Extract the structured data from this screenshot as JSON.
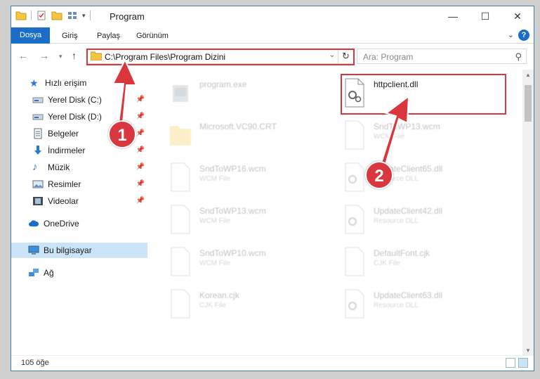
{
  "window": {
    "title": "Program",
    "controls": [
      "minimize",
      "maximize",
      "close"
    ]
  },
  "ribbon": {
    "tabs": [
      {
        "label": "Dosya",
        "active": true
      },
      {
        "label": "Giriş",
        "active": false
      },
      {
        "label": "Paylaş",
        "active": false
      },
      {
        "label": "Görünüm",
        "active": false
      }
    ],
    "help": "?"
  },
  "address": {
    "path": "C:\\Program Files\\Program Dizini",
    "search_placeholder": "Ara: Program"
  },
  "sidebar": {
    "items": [
      {
        "label": "Hızlı erişim",
        "icon": "star-icon",
        "pinned": false
      },
      {
        "label": "Yerel Disk (C:)",
        "icon": "drive-icon",
        "pinned": true
      },
      {
        "label": "Yerel Disk (D:)",
        "icon": "drive-icon",
        "pinned": true
      },
      {
        "label": "Belgeler",
        "icon": "documents-icon",
        "pinned": true
      },
      {
        "label": "İndirmeler",
        "icon": "download-icon",
        "pinned": true
      },
      {
        "label": "Müzik",
        "icon": "music-icon",
        "pinned": true
      },
      {
        "label": "Resimler",
        "icon": "pictures-icon",
        "pinned": true
      },
      {
        "label": "Videolar",
        "icon": "video-icon",
        "pinned": true
      },
      {
        "label": "OneDrive",
        "icon": "cloud-icon",
        "pinned": false
      },
      {
        "label": "Bu bilgisayar",
        "icon": "computer-icon",
        "pinned": false,
        "selected": true
      },
      {
        "label": "Ağ",
        "icon": "network-icon",
        "pinned": false
      }
    ]
  },
  "files": [
    {
      "name": "program.exe",
      "type": "",
      "faded": true,
      "kind": "exe"
    },
    {
      "name": "httpclient.dll",
      "type": "",
      "faded": false,
      "kind": "dll"
    },
    {
      "name": "Microsoft.VC90.CRT",
      "type": "",
      "faded": true,
      "kind": "folder"
    },
    {
      "name": "SndToWP13.wcm",
      "type": "WCM File",
      "faded": true,
      "kind": "doc"
    },
    {
      "name": "SndToWP16.wcm",
      "type": "WCM File",
      "faded": true,
      "kind": "doc"
    },
    {
      "name": "UpdateClient65.dll",
      "type": "Resource DLL",
      "faded": true,
      "kind": "dll"
    },
    {
      "name": "SndToWP13.wcm",
      "type": "WCM File",
      "faded": true,
      "kind": "doc"
    },
    {
      "name": "UpdateClient42.dll",
      "type": "Resource DLL",
      "faded": true,
      "kind": "dll"
    },
    {
      "name": "SndToWP10.wcm",
      "type": "WCM File",
      "faded": true,
      "kind": "doc"
    },
    {
      "name": "DefaultFont.cjk",
      "type": "CJK File",
      "faded": true,
      "kind": "doc"
    },
    {
      "name": "Korean.cjk",
      "type": "CJK File",
      "faded": true,
      "kind": "doc"
    },
    {
      "name": "UpdateClient63.dll",
      "type": "Resource DLL",
      "faded": true,
      "kind": "dll"
    }
  ],
  "status": {
    "count": "105 öğe"
  },
  "annotations": [
    {
      "label": "1"
    },
    {
      "label": "2"
    }
  ],
  "colors": {
    "accent": "#1a6ec7",
    "highlight": "#d9363e",
    "selected_bg": "#cce4f7"
  }
}
